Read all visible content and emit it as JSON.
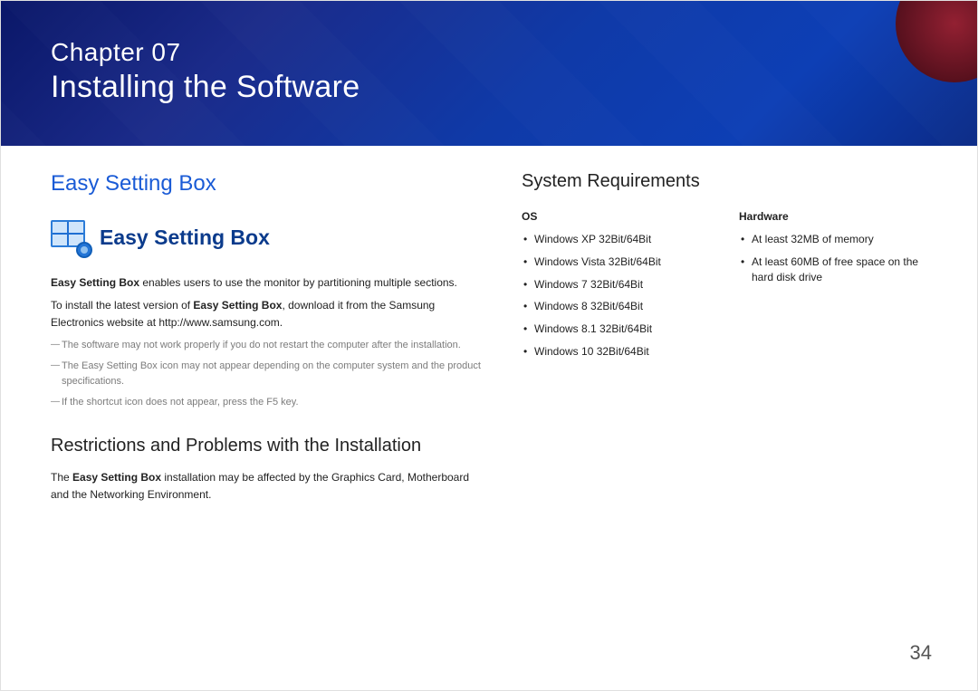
{
  "banner": {
    "chapterLine": "Chapter 07",
    "title": "Installing the Software"
  },
  "left": {
    "heading": "Easy Setting Box",
    "logoText": "Easy Setting Box",
    "p1_bold": "Easy Setting Box",
    "p1_rest": " enables users to use the monitor by partitioning multiple sections.",
    "p2_pre": "To install the latest version of ",
    "p2_bold": "Easy Setting Box",
    "p2_post": ", download it from the Samsung Electronics website at http://www.samsung.com.",
    "note1": "The software may not work properly if you do not restart the computer after the installation.",
    "note2_pre": "The ",
    "note2_bold": "Easy Setting Box",
    "note2_post": " icon may not appear depending on the computer system and the product specifications.",
    "note3": "If the shortcut icon does not appear, press the F5 key.",
    "h2": "Restrictions and Problems with the Installation",
    "p3_pre": "The ",
    "p3_bold": "Easy Setting Box",
    "p3_post": " installation may be affected by the Graphics Card, Motherboard and the Networking Environment."
  },
  "right": {
    "heading": "System Requirements",
    "osHeader": "OS",
    "hwHeader": "Hardware",
    "os": [
      "Windows XP 32Bit/64Bit",
      "Windows Vista 32Bit/64Bit",
      "Windows 7 32Bit/64Bit",
      "Windows 8 32Bit/64Bit",
      "Windows 8.1 32Bit/64Bit",
      "Windows 10 32Bit/64Bit"
    ],
    "hw": [
      "At least 32MB of memory",
      "At least 60MB of free space on the hard disk drive"
    ]
  },
  "pageNumber": "34"
}
